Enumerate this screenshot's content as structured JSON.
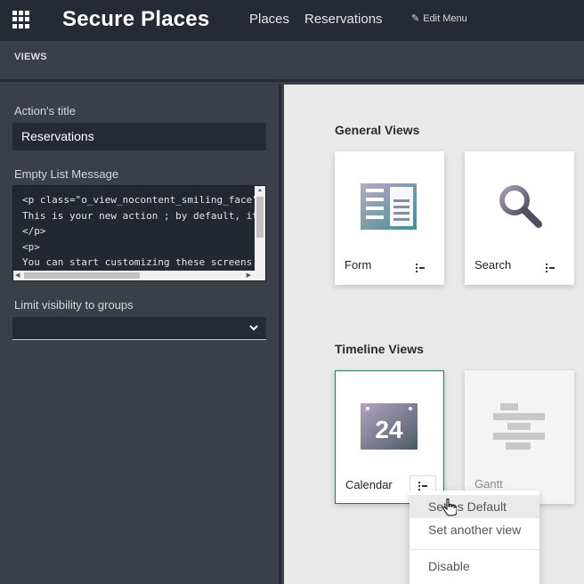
{
  "header": {
    "app_title": "Secure Places",
    "nav": [
      "Places",
      "Reservations"
    ],
    "edit_menu": "Edit Menu",
    "icons": {
      "apps": "apps-grid-icon",
      "edit": "pencil-icon"
    }
  },
  "views_bar": {
    "label": "VIEWS"
  },
  "sidebar": {
    "action_title_label": "Action's title",
    "action_title_value": "Reservations",
    "empty_list_label": "Empty List Message",
    "empty_list_lines": [
      "<p class=\"o_view_nocontent_smiling_face\">",
      "This is your new action ; by default, it",
      "</p>",
      "<p>",
      "You can start customizing these screens b"
    ],
    "groups_label": "Limit visibility to groups",
    "groups_value": ""
  },
  "main": {
    "general_title": "General Views",
    "timeline_title": "Timeline Views",
    "general_views": [
      {
        "label": "Form",
        "icon": "form-view-icon"
      },
      {
        "label": "Search",
        "icon": "magnifier-icon"
      }
    ],
    "timeline_views": [
      {
        "label": "Calendar",
        "icon": "calendar-icon",
        "badge": "24",
        "active": true
      },
      {
        "label": "Gantt",
        "icon": "gantt-icon",
        "active": false
      }
    ],
    "dropdown": {
      "items": [
        "Set as Default",
        "Set another view",
        "Disable"
      ]
    }
  },
  "colors": {
    "topbar": "#262a36",
    "sidebar": "#3a3f4a",
    "main_bg": "#e9e9e9",
    "accent": "#1f7a6a"
  }
}
